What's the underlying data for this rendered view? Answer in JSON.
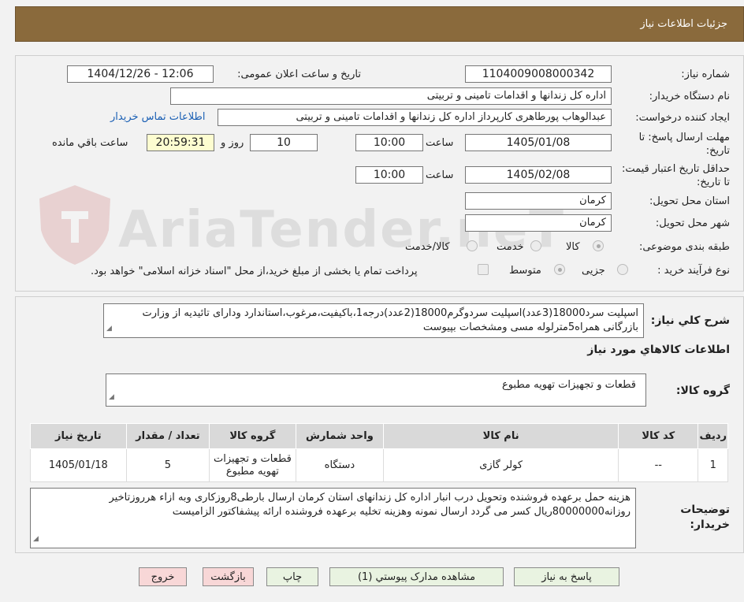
{
  "header": {
    "title": "جزئیات اطلاعات نیاز"
  },
  "watermark": {
    "text": "AriaTender.neT"
  },
  "form": {
    "need_number": {
      "label": "شماره نیاز:",
      "value": "1104009008000342"
    },
    "announce_datetime": {
      "label": "تاریخ و ساعت اعلان عمومی:",
      "value": "1404/12/26 - 12:06"
    },
    "buyer_org": {
      "label": "نام دستگاه خریدار:",
      "value": "اداره کل زندانها و اقدامات تامینی و تربیتی"
    },
    "requester": {
      "label": "ایجاد کننده درخواست:",
      "value": "عبدالوهاب پورطاهری کارپرداز اداره کل زندانها و اقدامات تامینی و تربیتی"
    },
    "contact_link": "اطلاعات تماس خریدار",
    "reply_deadline": {
      "label": "مهلت ارسال پاسخ: تا تاریخ:",
      "date": "1405/01/08",
      "time_label": "ساعت",
      "time": "10:00",
      "days": "10",
      "days_label": "روز و",
      "remaining": "20:59:31",
      "remaining_label": "ساعت باقي مانده"
    },
    "price_validity": {
      "label": "حداقل تاریخ اعتبار قیمت: تا تاریخ:",
      "date": "1405/02/08",
      "time_label": "ساعت",
      "time": "10:00"
    },
    "province": {
      "label": "استان محل تحویل:",
      "value": "کرمان"
    },
    "city": {
      "label": "شهر محل تحویل:",
      "value": "کرمان"
    },
    "category": {
      "label": "طبقه بندی موضوعی:",
      "options": [
        "کالا",
        "خدمت",
        "کالا/خدمت"
      ],
      "selected": "کالا"
    },
    "purchase_type": {
      "label": "نوع فرآیند خرید :",
      "options": [
        "جزیی",
        "متوسط"
      ],
      "selected": "متوسط",
      "payment_note": "پرداخت تمام یا بخشی از مبلغ خرید،از محل \"اسناد خزانه اسلامی\" خواهد بود."
    }
  },
  "details": {
    "summary_label": "شرح كلي نياز:",
    "summary": "اسپلیت سرد18000(3عدد)اسپلیت سردوگرم18000(2عدد)درجه1،باکیفیت،مرغوب،استاندارد ودارای تائیدیه از وزارت بازرگانی همراه5مترلوله مسی ومشخصات بپیوست",
    "goods_info_title": "اطلاعات كالاهاي مورد نياز",
    "goods_group_label": "گروه کالا:",
    "goods_group": "قطعات و تجهیزات تهویه مطبوع",
    "table": {
      "headers": [
        "رديف",
        "کد کالا",
        "نام کالا",
        "واحد شمارش",
        "گروه کالا",
        "تعداد / مقدار",
        "تاریخ نیاز"
      ],
      "rows": [
        [
          "1",
          "--",
          "کولر گازی",
          "دستگاه",
          "قطعات و تجهیزات تهویه مطبوع",
          "5",
          "1405/01/18"
        ]
      ]
    },
    "buyer_notes_label": "توضیحات خریدار:",
    "buyer_notes": "هزینه حمل برعهده فروشنده وتحویل درب انبار اداره کل زندانهای استان کرمان ارسال بارطی8روزکاری وبه ازاء هرروزتاخیر روزانه80000000ریال کسر می گردد ارسال نمونه وهزینه تخلیه برعهده فروشنده ارائه پیشفاکتور الزامیست"
  },
  "buttons": {
    "reply": "پاسخ به نیاز",
    "view_docs": "مشاهده مدارک پیوستي (1)",
    "print": "چاپ",
    "back": "بازگشت",
    "exit": "خروج"
  }
}
